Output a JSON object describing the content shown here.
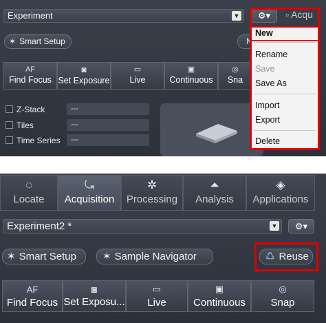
{
  "top_panel": {
    "experiment_value": "Experiment",
    "acquisition_tab_partial": "Acqu",
    "smart_setup_label": "Smart Setup",
    "n_partial": "N",
    "buttons": [
      {
        "icon": "AF",
        "label": "Find Focus"
      },
      {
        "icon": "camera-icon",
        "label": "Set Exposure"
      },
      {
        "icon": "live-icon",
        "label": "Live"
      },
      {
        "icon": "continuous-icon",
        "label": "Continuous"
      },
      {
        "icon": "snap-icon",
        "label": "Sna"
      }
    ],
    "options": [
      {
        "label": "Z-Stack",
        "value": "---"
      },
      {
        "label": "Tiles",
        "value": "---"
      },
      {
        "label": "Time Series",
        "value": "---"
      }
    ],
    "menu": {
      "items": [
        "New",
        "Rename",
        "Save",
        "Save As",
        "Import",
        "Export",
        "Delete"
      ],
      "disabled": [
        "Save"
      ],
      "selected": "New"
    }
  },
  "bottom_panel": {
    "tabs": [
      {
        "icon": "locate-icon",
        "label": "Locate",
        "active": false
      },
      {
        "icon": "acquisition-icon",
        "label": "Acquisition",
        "active": true
      },
      {
        "icon": "processing-icon",
        "label": "Processing",
        "active": false
      },
      {
        "icon": "analysis-icon",
        "label": "Analysis",
        "active": false
      },
      {
        "icon": "applications-icon",
        "label": "Applications",
        "active": false
      }
    ],
    "experiment_value": "Experiment2 *",
    "smart_setup_label": "Smart Setup",
    "sample_navigator_label": "Sample Navigator",
    "reuse_label": "Reuse",
    "buttons": [
      {
        "icon": "AF",
        "label": "Find Focus"
      },
      {
        "icon": "camera-icon",
        "label": "Set Exposu..."
      },
      {
        "icon": "live-icon",
        "label": "Live"
      },
      {
        "icon": "continuous-icon",
        "label": "Continuous"
      },
      {
        "icon": "snap-icon",
        "label": "Snap"
      }
    ]
  },
  "colors": {
    "highlight": "#e00000",
    "panel": "#343944",
    "menu_bg": "#f3f3f3"
  }
}
